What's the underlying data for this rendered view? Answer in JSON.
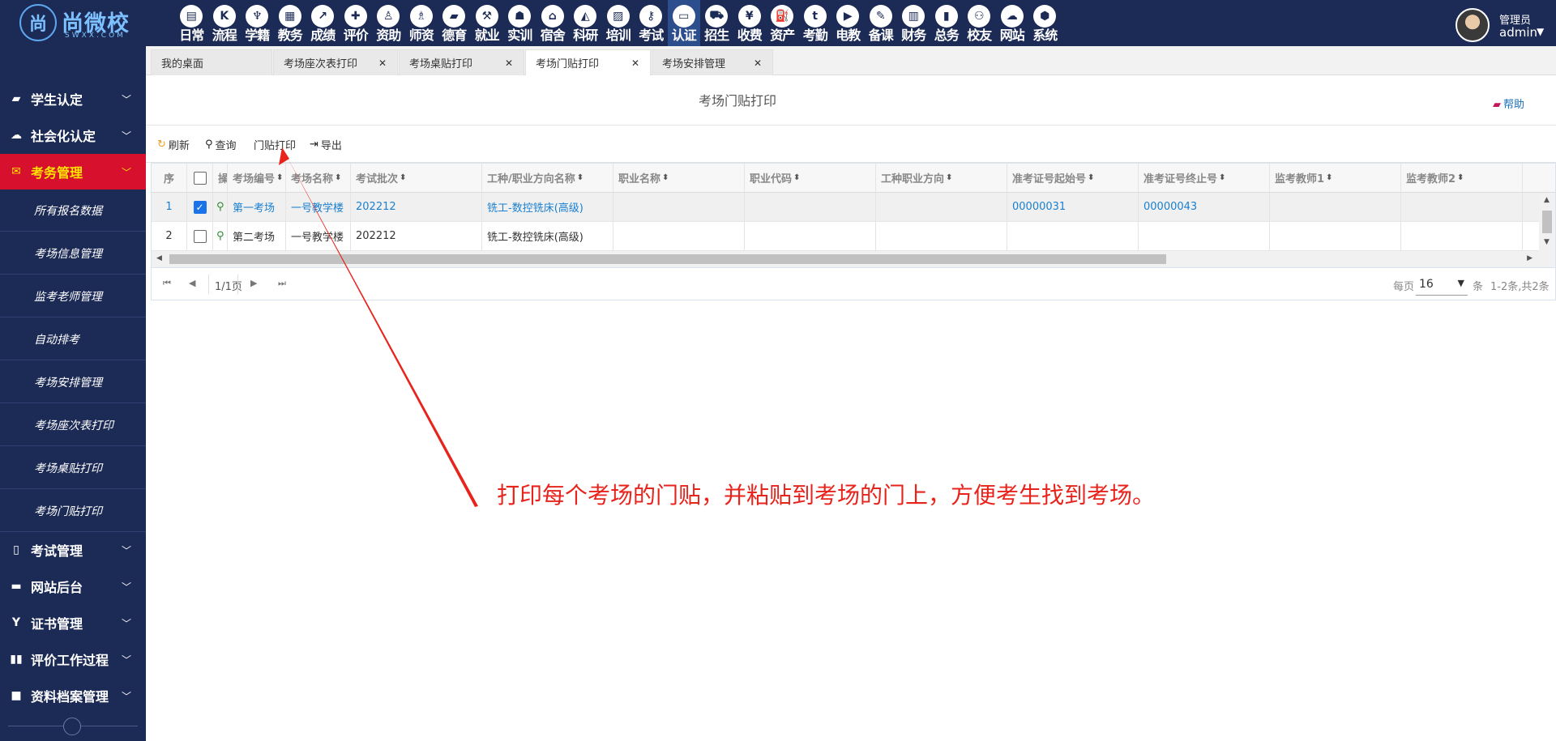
{
  "app": {
    "logo_brand": "尚微校",
    "logo_mark": "尚",
    "logo_sub": "SWXX.COM"
  },
  "topnav": [
    {
      "label": "日常",
      "icon": "doc-icon",
      "glyph": "▤"
    },
    {
      "label": "流程",
      "icon": "flow-icon",
      "glyph": "K"
    },
    {
      "label": "学籍",
      "icon": "student-icon",
      "glyph": "♆"
    },
    {
      "label": "教务",
      "icon": "calendar-icon",
      "glyph": "▦"
    },
    {
      "label": "成绩",
      "icon": "chart-icon",
      "glyph": "↗"
    },
    {
      "label": "评价",
      "icon": "evaluate-icon",
      "glyph": "✚"
    },
    {
      "label": "资助",
      "icon": "aid-icon",
      "glyph": "♙"
    },
    {
      "label": "师资",
      "icon": "teacher-icon",
      "glyph": "♗"
    },
    {
      "label": "德育",
      "icon": "book-icon",
      "glyph": "▰"
    },
    {
      "label": "就业",
      "icon": "hammer-icon",
      "glyph": "⚒"
    },
    {
      "label": "实训",
      "icon": "robot-icon",
      "glyph": "☗"
    },
    {
      "label": "宿舍",
      "icon": "home-icon",
      "glyph": "⌂"
    },
    {
      "label": "科研",
      "icon": "graduate-icon",
      "glyph": "◭"
    },
    {
      "label": "培训",
      "icon": "image-icon",
      "glyph": "▨"
    },
    {
      "label": "考试",
      "icon": "key-icon",
      "glyph": "⚷"
    },
    {
      "label": "认证",
      "icon": "monitor-icon",
      "glyph": "▭",
      "active": true
    },
    {
      "label": "招生",
      "icon": "car-icon",
      "glyph": "⛟"
    },
    {
      "label": "收费",
      "icon": "yen-icon",
      "glyph": "¥"
    },
    {
      "label": "资产",
      "icon": "bus-icon",
      "glyph": "⛽"
    },
    {
      "label": "考勤",
      "icon": "tumblr-icon",
      "glyph": "t"
    },
    {
      "label": "电教",
      "icon": "video-file-icon",
      "glyph": "▶"
    },
    {
      "label": "备课",
      "icon": "edit-icon",
      "glyph": "✎"
    },
    {
      "label": "财务",
      "icon": "newspaper-icon",
      "glyph": "▥"
    },
    {
      "label": "总务",
      "icon": "bar-chart-icon",
      "glyph": "▮"
    },
    {
      "label": "校友",
      "icon": "users-icon",
      "glyph": "⚇"
    },
    {
      "label": "网站",
      "icon": "cloud-icon",
      "glyph": "☁"
    },
    {
      "label": "系统",
      "icon": "cube-icon",
      "glyph": "⬢"
    }
  ],
  "user": {
    "role": "管理员",
    "name": "admin"
  },
  "sidebar": {
    "groups_top": [
      {
        "label": "学生认定",
        "icon": "book-icon",
        "glyph": "▰"
      },
      {
        "label": "社会化认定",
        "icon": "cloud-icon",
        "glyph": "☁"
      },
      {
        "label": "考务管理",
        "icon": "envelope-icon",
        "glyph": "✉",
        "active": true
      }
    ],
    "subitems": [
      "所有报名数据",
      "考场信息管理",
      "监考老师管理",
      "自动排考",
      "考场安排管理",
      "考场座次表打印",
      "考场桌贴打印",
      "考场门贴打印"
    ],
    "groups_bottom": [
      {
        "label": "考试管理",
        "icon": "file-icon",
        "glyph": "▯"
      },
      {
        "label": "网站后台",
        "icon": "folder-icon",
        "glyph": "▬"
      },
      {
        "label": "证书管理",
        "icon": "yahoo-icon",
        "glyph": "Y"
      },
      {
        "label": "评价工作过程",
        "icon": "columns-icon",
        "glyph": "▮▮"
      },
      {
        "label": "资料档案管理",
        "icon": "square-icon",
        "glyph": "■"
      }
    ]
  },
  "tabs": [
    {
      "label": "我的桌面",
      "closable": false
    },
    {
      "label": "考场座次表打印",
      "closable": true
    },
    {
      "label": "考场桌贴打印",
      "closable": true
    },
    {
      "label": "考场门贴打印",
      "closable": true,
      "active": true
    },
    {
      "label": "考场安排管理",
      "closable": true
    }
  ],
  "page": {
    "title": "考场门贴打印",
    "help": "帮助"
  },
  "toolbar": {
    "refresh": "刷新",
    "query": "查询",
    "door_print": "门贴打印",
    "export": "导出"
  },
  "grid": {
    "headers": [
      "序",
      "",
      "操作",
      "考场编号",
      "考场名称",
      "考试批次",
      "工种/职业方向名称",
      "职业名称",
      "职业代码",
      "工种职业方向",
      "准考证号起始号",
      "准考证号终止号",
      "监考教师1",
      "监考教师2"
    ],
    "rows": [
      {
        "seq": "1",
        "checked": true,
        "room_no": "第一考场",
        "room_name": "一号教学楼",
        "batch": "202212",
        "job": "铣工-数控铣床(高级)",
        "occupation": "",
        "code": "",
        "direction": "",
        "start_no": "00000031",
        "end_no": "00000043",
        "t1": "",
        "t2": ""
      },
      {
        "seq": "2",
        "checked": false,
        "room_no": "第二考场",
        "room_name": "一号教学楼",
        "batch": "202212",
        "job": "铣工-数控铣床(高级)",
        "occupation": "",
        "code": "",
        "direction": "",
        "start_no": "",
        "end_no": "",
        "t1": "",
        "t2": ""
      }
    ]
  },
  "pager": {
    "page_info": "1/1页",
    "per_page_label": "每页",
    "per_page": "16",
    "unit": "条",
    "total": "1-2条,共2条"
  },
  "annotation": {
    "text": "打印每个考场的门贴，并粘贴到考场的门上，方便考生找到考场。",
    "color": "#e8231c"
  },
  "colors": {
    "nav_bg": "#1c2b55",
    "active_side": "#d6102d",
    "active_side_text": "#ffe400",
    "link": "#1a7fd0"
  }
}
